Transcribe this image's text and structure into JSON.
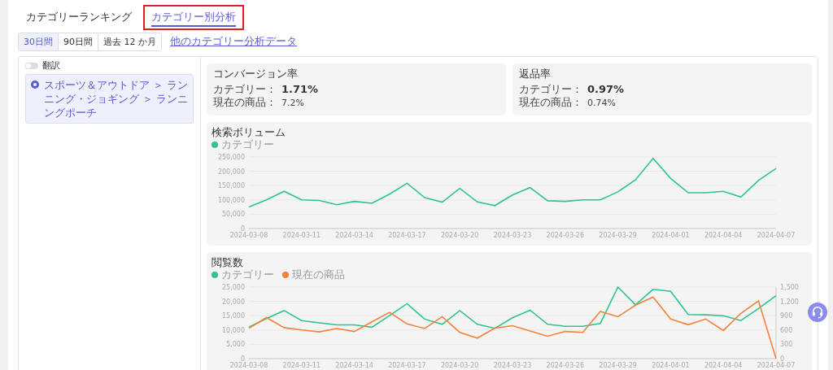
{
  "tabs": [
    {
      "label": "カテゴリーランキング",
      "selected": false,
      "highlighted": false
    },
    {
      "label": "カテゴリー別分析",
      "selected": true,
      "highlighted": true
    }
  ],
  "periods": [
    {
      "label": "30日間",
      "selected": true
    },
    {
      "label": "90日間",
      "selected": false
    },
    {
      "label": "過去 12 か月",
      "selected": false
    }
  ],
  "other_link": "他のカテゴリー分析データ",
  "translate": {
    "label": "翻訳",
    "on": false
  },
  "category": {
    "path": "スポーツ＆アウトドア ＞ ランニング・ジョギング ＞ ランニングポーチ",
    "selected": true
  },
  "metrics": [
    {
      "title": "コンバージョン率",
      "category_label": "カテゴリー：",
      "category_value": "1.71%",
      "product_label": "現在の商品：",
      "product_value": "7.2%"
    },
    {
      "title": "返品率",
      "category_label": "カテゴリー：",
      "category_value": "0.97%",
      "product_label": "現在の商品：",
      "product_value": "0.74%"
    }
  ],
  "charts": [
    {
      "title": "検索ボリューム",
      "chart_data": {
        "type": "line",
        "grid": true,
        "categories": [
          "2024-03-08",
          null,
          null,
          "2024-03-11",
          null,
          null,
          "2024-03-14",
          null,
          null,
          "2024-03-17",
          null,
          null,
          "2024-03-20",
          null,
          null,
          "2024-03-23",
          null,
          null,
          "2024-03-26",
          null,
          null,
          "2024-03-29",
          null,
          null,
          "2024-04-01",
          null,
          null,
          "2024-04-04",
          null,
          null,
          "2024-04-07"
        ],
        "ylim": [
          0,
          250000
        ],
        "yticks": [
          {
            "value": 0,
            "label": "0"
          },
          {
            "value": 50000,
            "label": "50,000"
          },
          {
            "value": 100000,
            "label": "100,000"
          },
          {
            "value": 150000,
            "label": "150,000"
          },
          {
            "value": 200000,
            "label": "200,000"
          },
          {
            "value": 250000,
            "label": "250,000"
          }
        ],
        "series": [
          {
            "name": "カテゴリー",
            "color": "#2ec48f",
            "values": [
              75000,
              100000,
              130000,
              100000,
              98000,
              83000,
              95000,
              88000,
              120000,
              158000,
              108000,
              92000,
              140000,
              93000,
              80000,
              117000,
              143000,
              97000,
              95000,
              100000,
              100000,
              128000,
              170000,
              245000,
              175000,
              125000,
              125000,
              130000,
              110000,
              168000,
              210000
            ]
          }
        ]
      }
    },
    {
      "title": "閲覧数",
      "chart_data": {
        "type": "line",
        "grid": true,
        "categories": [
          "2024-03-08",
          null,
          null,
          "2024-03-11",
          null,
          null,
          "2024-03-14",
          null,
          null,
          "2024-03-17",
          null,
          null,
          "2024-03-20",
          null,
          null,
          "2024-03-23",
          null,
          null,
          "2024-03-26",
          null,
          null,
          "2024-03-29",
          null,
          null,
          "2024-04-01",
          null,
          null,
          "2024-04-04",
          null,
          null,
          "2024-04-07"
        ],
        "ylim": [
          0,
          25000
        ],
        "yticks": [
          {
            "value": 0,
            "label": "0"
          },
          {
            "value": 5000,
            "label": "5,000"
          },
          {
            "value": 10000,
            "label": "10,000"
          },
          {
            "value": 15000,
            "label": "15,000"
          },
          {
            "value": 20000,
            "label": "20,000"
          },
          {
            "value": 25000,
            "label": "25,000"
          }
        ],
        "y2lim": [
          0,
          1500
        ],
        "y2ticks": [
          {
            "value": 0,
            "label": "0"
          },
          {
            "value": 300,
            "label": "300"
          },
          {
            "value": 600,
            "label": "600"
          },
          {
            "value": 900,
            "label": "900"
          },
          {
            "value": 1200,
            "label": "1,200"
          },
          {
            "value": 1500,
            "label": "1,500"
          }
        ],
        "series": [
          {
            "name": "カテゴリー",
            "color": "#2ec48f",
            "values": [
              11000,
              14000,
              16800,
              13300,
              12500,
              11800,
              11800,
              11000,
              15000,
              19200,
              13800,
              12000,
              16800,
              12000,
              10600,
              14300,
              16900,
              12000,
              11300,
              11300,
              12300,
              25000,
              18800,
              24200,
              23500,
              15400,
              15300,
              15000,
              13300,
              17500,
              22000
            ]
          },
          {
            "name": "現在の商品",
            "color": "#f5813a",
            "axis": "y2",
            "values": [
              640,
              860,
              650,
              600,
              560,
              630,
              570,
              770,
              970,
              730,
              630,
              880,
              550,
              430,
              640,
              690,
              580,
              470,
              570,
              550,
              990,
              880,
              1120,
              1290,
              830,
              710,
              830,
              590,
              950,
              1210,
              0
            ]
          }
        ]
      }
    }
  ]
}
